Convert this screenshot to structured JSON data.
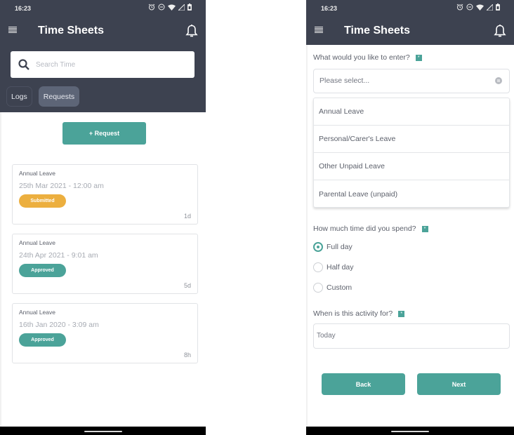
{
  "left": {
    "status_bar": {
      "time": "16:23"
    },
    "header": {
      "title": "Time Sheets"
    },
    "search": {
      "placeholder": "Search Time",
      "value": ""
    },
    "tabs": [
      {
        "label": "Logs",
        "active": false
      },
      {
        "label": "Requests",
        "active": true
      }
    ],
    "add_request_label": "+ Request",
    "requests": [
      {
        "type": "Annual Leave",
        "datetime": "25th Mar 2021 - 12:00 am",
        "status": "Submitted",
        "age": "1d"
      },
      {
        "type": "Annual Leave",
        "datetime": "24th Apr 2021 - 9:01 am",
        "status": "Approved",
        "age": "5d"
      },
      {
        "type": "Annual Leave",
        "datetime": "16th Jan 2020 - 3:09 am",
        "status": "Approved",
        "age": "8h"
      }
    ]
  },
  "right": {
    "status_bar": {
      "time": "16:23"
    },
    "header": {
      "title": "Time Sheets"
    },
    "entry_type": {
      "label": "What would you like to enter?",
      "placeholder": "Please select...",
      "options": [
        "Annual Leave",
        "Personal/Carer's Leave",
        "Other Unpaid Leave",
        "Parental Leave (unpaid)"
      ]
    },
    "time_spent": {
      "label": "How much time did you spend?",
      "options": [
        "Full day",
        "Half day",
        "Custom"
      ],
      "selected": "Full day"
    },
    "activity_date": {
      "label": "When is this activity for?",
      "value": "Today"
    },
    "buttons": {
      "back": "Back",
      "next": "Next"
    },
    "required_mark": "*"
  },
  "colors": {
    "header_bg": "#3d4250",
    "accent": "#4ba399",
    "submitted": "#ecaf3f",
    "approved": "#4ba399"
  },
  "icons": [
    "menu-icon",
    "bell-icon",
    "search-icon",
    "alarm-icon",
    "dnd-icon",
    "wifi-icon",
    "signal-icon",
    "battery-icon",
    "clear-icon"
  ]
}
